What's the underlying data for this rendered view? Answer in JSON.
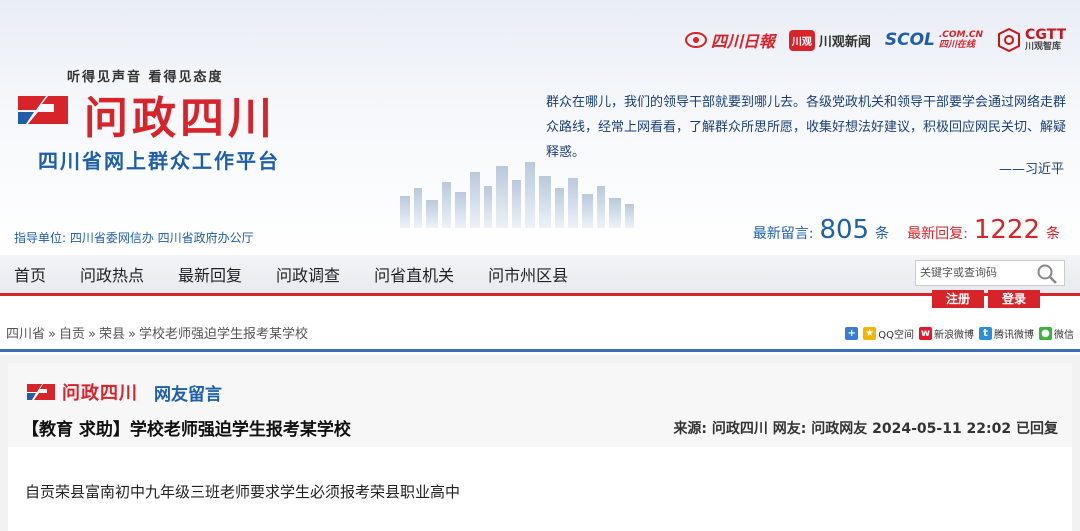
{
  "header": {
    "slogan": "听得见声音  看得见态度",
    "logo_title": "问政四川",
    "logo_sub": "四川省网上群众工作平台",
    "partners": {
      "scdaily": "四川日報",
      "chuanguan_badge": "川观",
      "chuanguan": "川观新闻",
      "scol": "SCOL",
      "scol_domain": ".COM.CN",
      "scol_cn": "四川在线",
      "cgtt": "CGTT",
      "cgtt_cn": "川观智库"
    },
    "quote": "群众在哪儿，我们的领导干部就要到哪儿去。各级党政机关和领导干部要学会通过网络走群众路线，经常上网看看，了解群众所思所愿，收集好想法好建议，积极回应网民关切、解疑释惑。",
    "quote_author": "——习近平",
    "guide": "指导单位: 四川省委网信办  四川省政府办公厅",
    "stats": {
      "latest_msg_label": "最新留言:",
      "latest_msg_count": "805",
      "latest_msg_unit": "条",
      "latest_reply_label": "最新回复:",
      "latest_reply_count": "1222",
      "latest_reply_unit": "条"
    }
  },
  "nav": {
    "items": [
      "首页",
      "问政热点",
      "最新回复",
      "问政调查",
      "问省直机关",
      "问市州区县"
    ],
    "search_placeholder": "关键字或查询码",
    "register": "注册",
    "login": "登录"
  },
  "breadcrumb": {
    "items": [
      "四川省",
      "自贡",
      "荣县",
      "学校老师强迫学生报考某学校"
    ],
    "sep": "»"
  },
  "share": {
    "items": [
      "QQ空间",
      "新浪微博",
      "腾讯微博",
      "微信"
    ]
  },
  "post": {
    "brand": "问政四川",
    "section": "网友留言",
    "title": "【教育 求助】学校老师强迫学生报考某学校",
    "meta": "来源: 问政四川 网友: 问政网友  2024-05-11 22:02 已回复",
    "body": "自贡荣县富南初中九年级三班老师要求学生必须报考荣县职业高中"
  },
  "colors": {
    "brand_red": "#d7232a",
    "brand_blue": "#1e5fa8",
    "rule_blue": "#3a6fb7"
  }
}
